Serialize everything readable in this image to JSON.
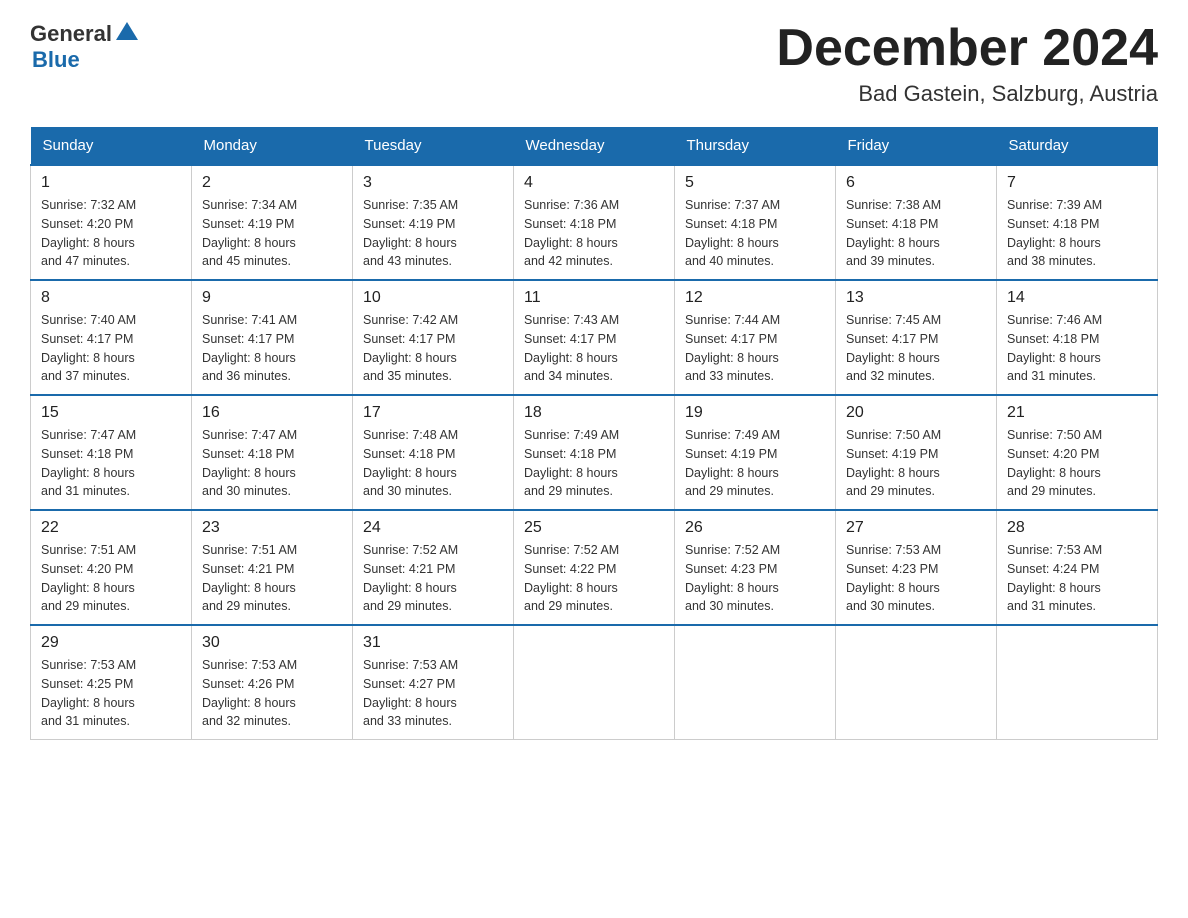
{
  "header": {
    "logo_general": "General",
    "logo_blue": "Blue",
    "month_title": "December 2024",
    "location": "Bad Gastein, Salzburg, Austria"
  },
  "days_of_week": [
    "Sunday",
    "Monday",
    "Tuesday",
    "Wednesday",
    "Thursday",
    "Friday",
    "Saturday"
  ],
  "weeks": [
    [
      {
        "day": "1",
        "sunrise": "7:32 AM",
        "sunset": "4:20 PM",
        "daylight": "8 hours and 47 minutes."
      },
      {
        "day": "2",
        "sunrise": "7:34 AM",
        "sunset": "4:19 PM",
        "daylight": "8 hours and 45 minutes."
      },
      {
        "day": "3",
        "sunrise": "7:35 AM",
        "sunset": "4:19 PM",
        "daylight": "8 hours and 43 minutes."
      },
      {
        "day": "4",
        "sunrise": "7:36 AM",
        "sunset": "4:18 PM",
        "daylight": "8 hours and 42 minutes."
      },
      {
        "day": "5",
        "sunrise": "7:37 AM",
        "sunset": "4:18 PM",
        "daylight": "8 hours and 40 minutes."
      },
      {
        "day": "6",
        "sunrise": "7:38 AM",
        "sunset": "4:18 PM",
        "daylight": "8 hours and 39 minutes."
      },
      {
        "day": "7",
        "sunrise": "7:39 AM",
        "sunset": "4:18 PM",
        "daylight": "8 hours and 38 minutes."
      }
    ],
    [
      {
        "day": "8",
        "sunrise": "7:40 AM",
        "sunset": "4:17 PM",
        "daylight": "8 hours and 37 minutes."
      },
      {
        "day": "9",
        "sunrise": "7:41 AM",
        "sunset": "4:17 PM",
        "daylight": "8 hours and 36 minutes."
      },
      {
        "day": "10",
        "sunrise": "7:42 AM",
        "sunset": "4:17 PM",
        "daylight": "8 hours and 35 minutes."
      },
      {
        "day": "11",
        "sunrise": "7:43 AM",
        "sunset": "4:17 PM",
        "daylight": "8 hours and 34 minutes."
      },
      {
        "day": "12",
        "sunrise": "7:44 AM",
        "sunset": "4:17 PM",
        "daylight": "8 hours and 33 minutes."
      },
      {
        "day": "13",
        "sunrise": "7:45 AM",
        "sunset": "4:17 PM",
        "daylight": "8 hours and 32 minutes."
      },
      {
        "day": "14",
        "sunrise": "7:46 AM",
        "sunset": "4:18 PM",
        "daylight": "8 hours and 31 minutes."
      }
    ],
    [
      {
        "day": "15",
        "sunrise": "7:47 AM",
        "sunset": "4:18 PM",
        "daylight": "8 hours and 31 minutes."
      },
      {
        "day": "16",
        "sunrise": "7:47 AM",
        "sunset": "4:18 PM",
        "daylight": "8 hours and 30 minutes."
      },
      {
        "day": "17",
        "sunrise": "7:48 AM",
        "sunset": "4:18 PM",
        "daylight": "8 hours and 30 minutes."
      },
      {
        "day": "18",
        "sunrise": "7:49 AM",
        "sunset": "4:18 PM",
        "daylight": "8 hours and 29 minutes."
      },
      {
        "day": "19",
        "sunrise": "7:49 AM",
        "sunset": "4:19 PM",
        "daylight": "8 hours and 29 minutes."
      },
      {
        "day": "20",
        "sunrise": "7:50 AM",
        "sunset": "4:19 PM",
        "daylight": "8 hours and 29 minutes."
      },
      {
        "day": "21",
        "sunrise": "7:50 AM",
        "sunset": "4:20 PM",
        "daylight": "8 hours and 29 minutes."
      }
    ],
    [
      {
        "day": "22",
        "sunrise": "7:51 AM",
        "sunset": "4:20 PM",
        "daylight": "8 hours and 29 minutes."
      },
      {
        "day": "23",
        "sunrise": "7:51 AM",
        "sunset": "4:21 PM",
        "daylight": "8 hours and 29 minutes."
      },
      {
        "day": "24",
        "sunrise": "7:52 AM",
        "sunset": "4:21 PM",
        "daylight": "8 hours and 29 minutes."
      },
      {
        "day": "25",
        "sunrise": "7:52 AM",
        "sunset": "4:22 PM",
        "daylight": "8 hours and 29 minutes."
      },
      {
        "day": "26",
        "sunrise": "7:52 AM",
        "sunset": "4:23 PM",
        "daylight": "8 hours and 30 minutes."
      },
      {
        "day": "27",
        "sunrise": "7:53 AM",
        "sunset": "4:23 PM",
        "daylight": "8 hours and 30 minutes."
      },
      {
        "day": "28",
        "sunrise": "7:53 AM",
        "sunset": "4:24 PM",
        "daylight": "8 hours and 31 minutes."
      }
    ],
    [
      {
        "day": "29",
        "sunrise": "7:53 AM",
        "sunset": "4:25 PM",
        "daylight": "8 hours and 31 minutes."
      },
      {
        "day": "30",
        "sunrise": "7:53 AM",
        "sunset": "4:26 PM",
        "daylight": "8 hours and 32 minutes."
      },
      {
        "day": "31",
        "sunrise": "7:53 AM",
        "sunset": "4:27 PM",
        "daylight": "8 hours and 33 minutes."
      },
      null,
      null,
      null,
      null
    ]
  ],
  "labels": {
    "sunrise": "Sunrise:",
    "sunset": "Sunset:",
    "daylight": "Daylight:"
  }
}
